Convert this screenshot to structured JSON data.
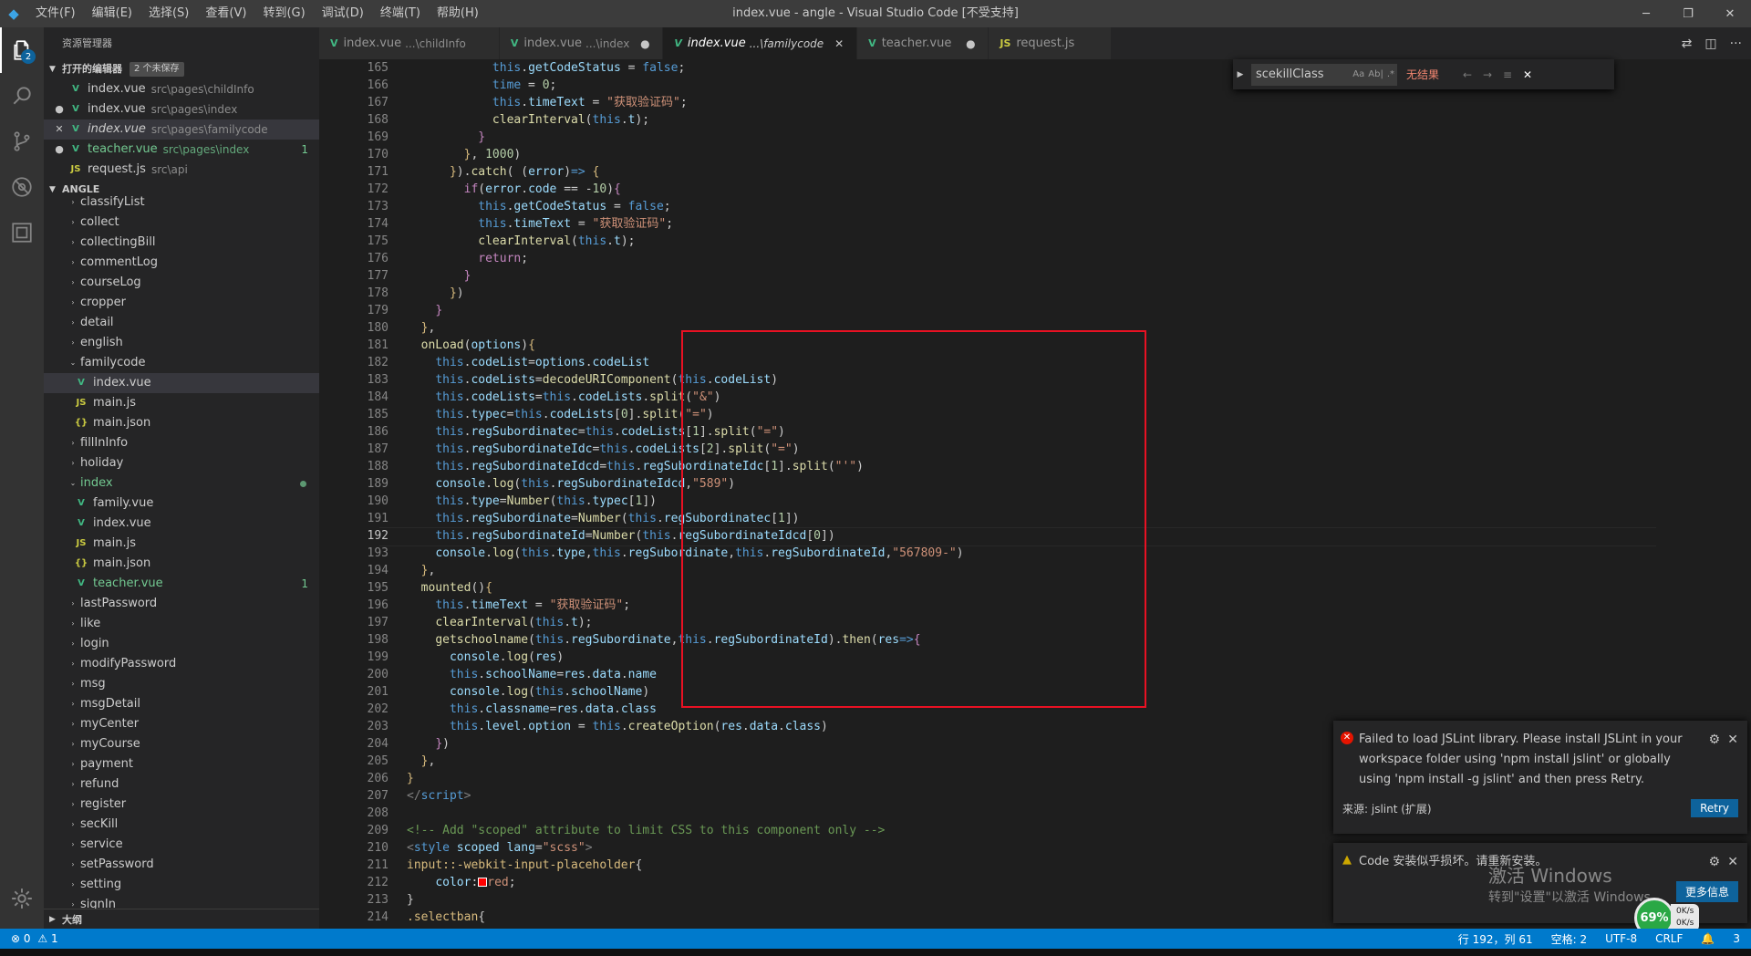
{
  "titlebar": {
    "logo": "◆",
    "menus": [
      "文件(F)",
      "编辑(E)",
      "选择(S)",
      "查看(V)",
      "转到(G)",
      "调试(D)",
      "终端(T)",
      "帮助(H)"
    ],
    "title": "index.vue - angle - Visual Studio Code [不受支持]",
    "controls": [
      "─",
      "❐",
      "✕"
    ]
  },
  "activity": {
    "explorer_badge": "2"
  },
  "sidebar": {
    "title": "资源管理器",
    "open_editors_label": "打开的编辑器",
    "open_editors_dirty": "2 个未保存",
    "open_editors": [
      {
        "name": "index.vue",
        "path": "src\\pages\\childInfo",
        "lead": "",
        "icon": "V"
      },
      {
        "name": "index.vue",
        "path": "src\\pages\\index",
        "lead": "●",
        "icon": "V"
      },
      {
        "name": "index.vue",
        "path": "src\\pages\\familycode",
        "lead": "✕",
        "icon": "V"
      },
      {
        "name": "teacher.vue",
        "path": "src\\pages\\index",
        "lead": "●",
        "icon": "V",
        "count": "1"
      },
      {
        "name": "request.js",
        "path": "src\\api",
        "lead": "",
        "icon": "JS"
      }
    ],
    "project_label": "ANGLE",
    "tree": [
      {
        "name": "classifyList",
        "indent": 1,
        "twisty": "›"
      },
      {
        "name": "collect",
        "indent": 1,
        "twisty": "›"
      },
      {
        "name": "collectingBill",
        "indent": 1,
        "twisty": "›"
      },
      {
        "name": "commentLog",
        "indent": 1,
        "twisty": "›"
      },
      {
        "name": "courseLog",
        "indent": 1,
        "twisty": "›"
      },
      {
        "name": "cropper",
        "indent": 1,
        "twisty": "›"
      },
      {
        "name": "detail",
        "indent": 1,
        "twisty": "›"
      },
      {
        "name": "english",
        "indent": 1,
        "twisty": "›"
      },
      {
        "name": "familycode",
        "indent": 1,
        "twisty": "⌄"
      },
      {
        "name": "index.vue",
        "indent": 2,
        "icon": "V"
      },
      {
        "name": "main.js",
        "indent": 2,
        "icon": "JS"
      },
      {
        "name": "main.json",
        "indent": 2,
        "icon": "{}"
      },
      {
        "name": "fillInInfo",
        "indent": 1,
        "twisty": "›"
      },
      {
        "name": "holiday",
        "indent": 1,
        "twisty": "›"
      },
      {
        "name": "index",
        "indent": 1,
        "twisty": "⌄"
      },
      {
        "name": "family.vue",
        "indent": 2,
        "icon": "V"
      },
      {
        "name": "index.vue",
        "indent": 2,
        "icon": "V"
      },
      {
        "name": "main.js",
        "indent": 2,
        "icon": "JS"
      },
      {
        "name": "main.json",
        "indent": 2,
        "icon": "{}"
      },
      {
        "name": "teacher.vue",
        "indent": 2,
        "icon": "V",
        "count": "1"
      },
      {
        "name": "lastPassword",
        "indent": 1,
        "twisty": "›"
      },
      {
        "name": "like",
        "indent": 1,
        "twisty": "›"
      },
      {
        "name": "login",
        "indent": 1,
        "twisty": "›"
      },
      {
        "name": "modifyPassword",
        "indent": 1,
        "twisty": "›"
      },
      {
        "name": "msg",
        "indent": 1,
        "twisty": "›"
      },
      {
        "name": "msgDetail",
        "indent": 1,
        "twisty": "›"
      },
      {
        "name": "myCenter",
        "indent": 1,
        "twisty": "›"
      },
      {
        "name": "myCourse",
        "indent": 1,
        "twisty": "›"
      },
      {
        "name": "payment",
        "indent": 1,
        "twisty": "›"
      },
      {
        "name": "refund",
        "indent": 1,
        "twisty": "›"
      },
      {
        "name": "register",
        "indent": 1,
        "twisty": "›"
      },
      {
        "name": "secKill",
        "indent": 1,
        "twisty": "›"
      },
      {
        "name": "service",
        "indent": 1,
        "twisty": "›"
      },
      {
        "name": "setPassword",
        "indent": 1,
        "twisty": "›"
      },
      {
        "name": "setting",
        "indent": 1,
        "twisty": "›"
      },
      {
        "name": "signIn",
        "indent": 1,
        "twisty": "›"
      }
    ],
    "outline_label": "大纲"
  },
  "tabs": [
    {
      "name": "index.vue",
      "desc": "...\\childInfo",
      "icon": "V",
      "close": ""
    },
    {
      "name": "index.vue",
      "desc": "...\\index",
      "icon": "V",
      "close": "●"
    },
    {
      "name": "index.vue",
      "desc": "...\\familycode",
      "icon": "V",
      "close": "✕"
    },
    {
      "name": "teacher.vue",
      "desc": "",
      "icon": "V",
      "close": "●"
    },
    {
      "name": "request.js",
      "desc": "",
      "icon": "JS",
      "close": ""
    }
  ],
  "find": {
    "query": "scekillClass",
    "result": "无结果",
    "opts": [
      "Aa",
      "Ab|",
      ".*"
    ]
  },
  "code_lines": [
    {
      "n": "165",
      "html": "            <span class='k'>this</span>.<span class='v'>getCodeStatus</span> = <span class='k'>false</span>;"
    },
    {
      "n": "166",
      "html": "            <span class='k'>time</span> = <span class='n'>0</span>;"
    },
    {
      "n": "167",
      "html": "            <span class='k'>this</span>.<span class='v'>timeText</span> = <span class='s'>\"获取验证码\"</span>;"
    },
    {
      "n": "168",
      "html": "            <span class='f'>clearInterval</span>(<span class='k'>this</span>.<span class='v'>t</span>);"
    },
    {
      "n": "169",
      "html": "          <span class='p'>}</span>"
    },
    {
      "n": "170",
      "html": "        <span class='y'>}</span>, <span class='n'>1000</span>)"
    },
    {
      "n": "171",
      "html": "      <span class='y'>}</span>).<span class='f'>catch</span>( (<span class='v'>error</span>)<span class='k'>=></span> <span class='y'>{</span>"
    },
    {
      "n": "172",
      "html": "        <span class='p'>if</span>(<span class='v'>error</span>.<span class='v'>code</span> == -<span class='n'>10</span>)<span class='p'>{</span>"
    },
    {
      "n": "173",
      "html": "          <span class='k'>this</span>.<span class='v'>getCodeStatus</span> = <span class='k'>false</span>;"
    },
    {
      "n": "174",
      "html": "          <span class='k'>this</span>.<span class='v'>timeText</span> = <span class='s'>\"获取验证码\"</span>;"
    },
    {
      "n": "175",
      "html": "          <span class='f'>clearInterval</span>(<span class='k'>this</span>.<span class='v'>t</span>);"
    },
    {
      "n": "176",
      "html": "          <span class='p'>return</span>;"
    },
    {
      "n": "177",
      "html": "        <span class='p'>}</span>"
    },
    {
      "n": "178",
      "html": "      <span class='y'>}</span>)"
    },
    {
      "n": "179",
      "html": "    <span class='p'>}</span>"
    },
    {
      "n": "180",
      "html": "  <span class='y'>}</span>,"
    },
    {
      "n": "181",
      "html": "  <span class='f'>onLoad</span>(<span class='v'>options</span>)<span class='y'>{</span>"
    },
    {
      "n": "182",
      "html": "    <span class='k'>this</span>.<span class='v'>codeList</span>=<span class='v'>options</span>.<span class='v'>codeList</span>"
    },
    {
      "n": "183",
      "html": "    <span class='k'>this</span>.<span class='v'>codeLists</span>=<span class='f'>decodeURIComponent</span>(<span class='k'>this</span>.<span class='v'>codeList</span>)"
    },
    {
      "n": "184",
      "html": "    <span class='k'>this</span>.<span class='v'>codeLists</span>=<span class='k'>this</span>.<span class='v'>codeLists</span>.<span class='f'>split</span>(<span class='s'>\"&amp;\"</span>)"
    },
    {
      "n": "185",
      "html": "    <span class='k'>this</span>.<span class='v'>typec</span>=<span class='k'>this</span>.<span class='v'>codeLists</span>[<span class='n'>0</span>].<span class='f'>split</span>(<span class='s'>\"=\"</span>)"
    },
    {
      "n": "186",
      "html": "    <span class='k'>this</span>.<span class='v'>regSubordinatec</span>=<span class='k'>this</span>.<span class='v'>codeLists</span>[<span class='n'>1</span>].<span class='f'>split</span>(<span class='s'>\"=\"</span>)"
    },
    {
      "n": "187",
      "html": "    <span class='k'>this</span>.<span class='v'>regSubordinateIdc</span>=<span class='k'>this</span>.<span class='v'>codeLists</span>[<span class='n'>2</span>].<span class='f'>split</span>(<span class='s'>\"=\"</span>)"
    },
    {
      "n": "188",
      "html": "    <span class='k'>this</span>.<span class='v'>regSubordinateIdcd</span>=<span class='k'>this</span>.<span class='v'>regSubordinateIdc</span>[<span class='n'>1</span>].<span class='f'>split</span>(<span class='s'>\"'\"</span>)"
    },
    {
      "n": "189",
      "html": "    <span class='v'>console</span>.<span class='f'>log</span>(<span class='k'>this</span>.<span class='v'>regSubordinateIdcd</span>,<span class='s'>\"589\"</span>)"
    },
    {
      "n": "190",
      "html": "    <span class='k'>this</span>.<span class='v'>type</span>=<span class='f'>Number</span>(<span class='k'>this</span>.<span class='v'>typec</span>[<span class='n'>1</span>])"
    },
    {
      "n": "191",
      "html": "    <span class='k'>this</span>.<span class='v'>regSubordinate</span>=<span class='f'>Number</span>(<span class='k'>this</span>.<span class='v'>regSubordinatec</span>[<span class='n'>1</span>])"
    },
    {
      "n": "192",
      "html": "    <span class='k'>this</span>.<span class='v'>regSubordinateId</span>=<span class='f'>Number</span>(<span class='k'>this</span>.<span class='v'>regSubordinateIdcd</span>[<span class='n'>0</span>])"
    },
    {
      "n": "193",
      "html": "    <span class='v'>console</span>.<span class='f'>log</span>(<span class='k'>this</span>.<span class='v'>type</span>,<span class='k'>this</span>.<span class='v'>regSubordinate</span>,<span class='k'>this</span>.<span class='v'>regSubordinateId</span>,<span class='s'>\"567809-\"</span>)"
    },
    {
      "n": "194",
      "html": "  <span class='y'>}</span>,"
    },
    {
      "n": "195",
      "html": "  <span class='f'>mounted</span>()<span class='y'>{</span>"
    },
    {
      "n": "196",
      "html": "    <span class='k'>this</span>.<span class='v'>timeText</span> = <span class='s'>\"获取验证码\"</span>;"
    },
    {
      "n": "197",
      "html": "    <span class='f'>clearInterval</span>(<span class='k'>this</span>.<span class='v'>t</span>);"
    },
    {
      "n": "198",
      "html": "    <span class='f'>getschoolname</span>(<span class='k'>this</span>.<span class='v'>regSubordinate</span>,<span class='k'>this</span>.<span class='v'>regSubordinateId</span>).<span class='f'>then</span>(<span class='v'>res</span><span class='k'>=></span><span class='p'>{</span>"
    },
    {
      "n": "199",
      "html": "      <span class='v'>console</span>.<span class='f'>log</span>(<span class='v'>res</span>)"
    },
    {
      "n": "200",
      "html": "      <span class='k'>this</span>.<span class='v'>schoolName</span>=<span class='v'>res</span>.<span class='v'>data</span>.<span class='v'>name</span>"
    },
    {
      "n": "201",
      "html": "      <span class='v'>console</span>.<span class='f'>log</span>(<span class='k'>this</span>.<span class='v'>schoolName</span>)"
    },
    {
      "n": "202",
      "html": "      <span class='k'>this</span>.<span class='v'>classname</span>=<span class='v'>res</span>.<span class='v'>data</span>.<span class='v'>class</span>"
    },
    {
      "n": "203",
      "html": "      <span class='k'>this</span>.<span class='v'>level</span>.<span class='v'>option</span> = <span class='k'>this</span>.<span class='f'>createOption</span>(<span class='v'>res</span>.<span class='v'>data</span>.<span class='v'>class</span>)"
    },
    {
      "n": "204",
      "html": "    <span class='p'>}</span>)"
    },
    {
      "n": "205",
      "html": "  <span class='y'>}</span>,"
    },
    {
      "n": "206",
      "html": "<span class='y'>}</span>"
    },
    {
      "n": "207",
      "html": "<span class='t'>&lt;/</span><span class='k'>script</span><span class='t'>&gt;</span>"
    },
    {
      "n": "208",
      "html": ""
    },
    {
      "n": "209",
      "html": "<span class='c'>&lt;!-- Add \"scoped\" attribute to limit CSS to this component only --&gt;</span>"
    },
    {
      "n": "210",
      "html": "<span class='t'>&lt;</span><span class='k'>style</span> <span class='v'>scoped</span> <span class='v'>lang</span>=<span class='s'>\"scss\"</span><span class='t'>&gt;</span>"
    },
    {
      "n": "211",
      "html": "<span class='y'>input::-webkit-input-placeholder</span>{"
    },
    {
      "n": "212",
      "html": "    <span class='v'>color</span>:<span style='display:inline-block;width:10px;height:10px;border:1px solid #fff;background:#ff0000;vertical-align:-1px;'></span><span class='s'>red</span>;"
    },
    {
      "n": "213",
      "html": "}"
    },
    {
      "n": "214",
      "html": "<span class='y'>.selectban</span>{"
    }
  ],
  "current_line": "192",
  "notifications": {
    "jslint": {
      "message": "Failed to load JSLint library. Please install JSLint in your workspace folder using 'npm install jslint' or globally using 'npm install -g jslint' and then press Retry.",
      "source": "来源: jslint (扩展)",
      "button": "Retry"
    },
    "code": {
      "message": "Code 安装似乎损坏。请重新安装。",
      "button": "更多信息"
    }
  },
  "activation": {
    "line1": "激活 Windows",
    "line2": "转到\"设置\"以激活 Windows。"
  },
  "network": {
    "percent": "69%",
    "up": "0K/s",
    "down": "0K/s"
  },
  "statusbar": {
    "errors": "0",
    "warnings": "1",
    "position": "行 192，列 61",
    "spaces": "空格: 2",
    "encoding": "UTF-8",
    "eol": "CRLF",
    "bell": "🔔",
    "notif": "3"
  },
  "colors": {
    "accent": "#007acc",
    "vue": "#41b883",
    "error": "#e81123",
    "highlight_box": "#e81123"
  }
}
